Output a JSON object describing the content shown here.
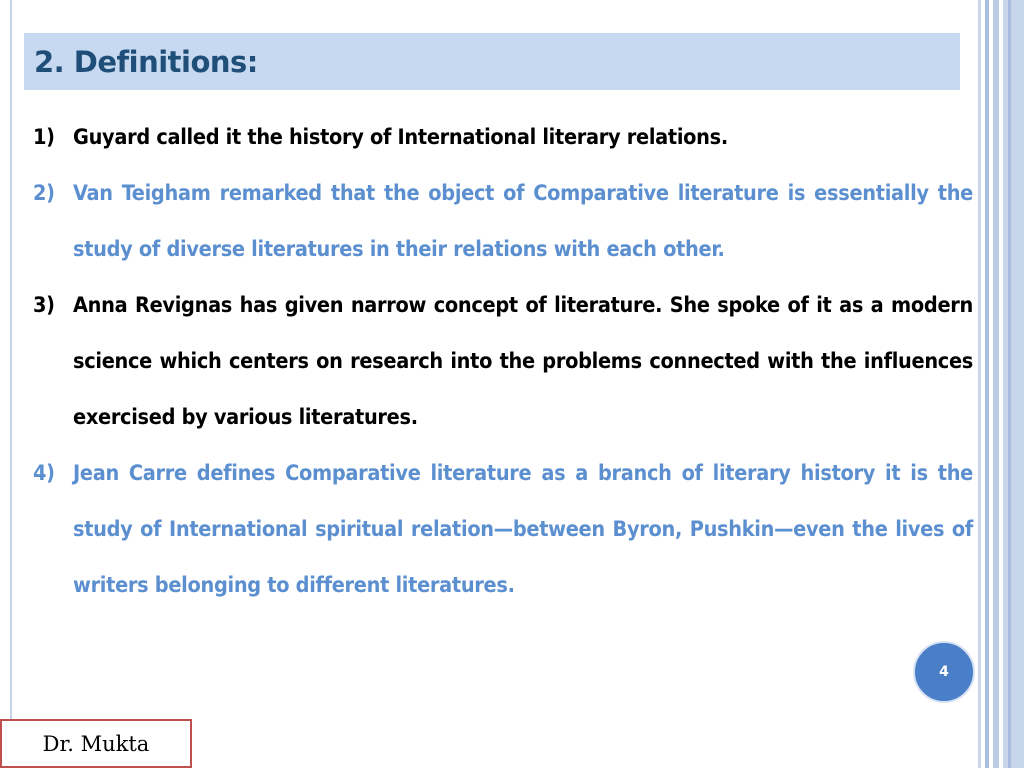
{
  "slide": {
    "title": "2. Definitions:",
    "page_number": "4",
    "author": "Dr. Mukta"
  },
  "items": [
    {
      "num": "1)",
      "text": "Guyard called it the history of International literary relations.",
      "color": "#000000"
    },
    {
      "num": "2)",
      "text": "Van Teigham remarked that the object of Comparative literature is essentially the study of diverse literatures in their relations with each other.",
      "color": "#5b8fd0"
    },
    {
      "num": "3)",
      "text": "Anna Revignas has given narrow concept of literature. She spoke of it as a modern science which centers on research into the problems connected with the influences exercised by various literatures.",
      "color": "#000000"
    },
    {
      "num": "4)",
      "text": "Jean Carre defines Comparative literature as a branch of literary history it is the study of International spiritual relation—between Byron, Pushkin—even the lives of writers belonging to different literatures.",
      "color": "#5b8fd0"
    }
  ],
  "colors": {
    "title_bar": "#c6d9f1",
    "title_text": "#1f4e79",
    "page_circle": "#4a7ec6",
    "author_border": "#c0504d"
  }
}
